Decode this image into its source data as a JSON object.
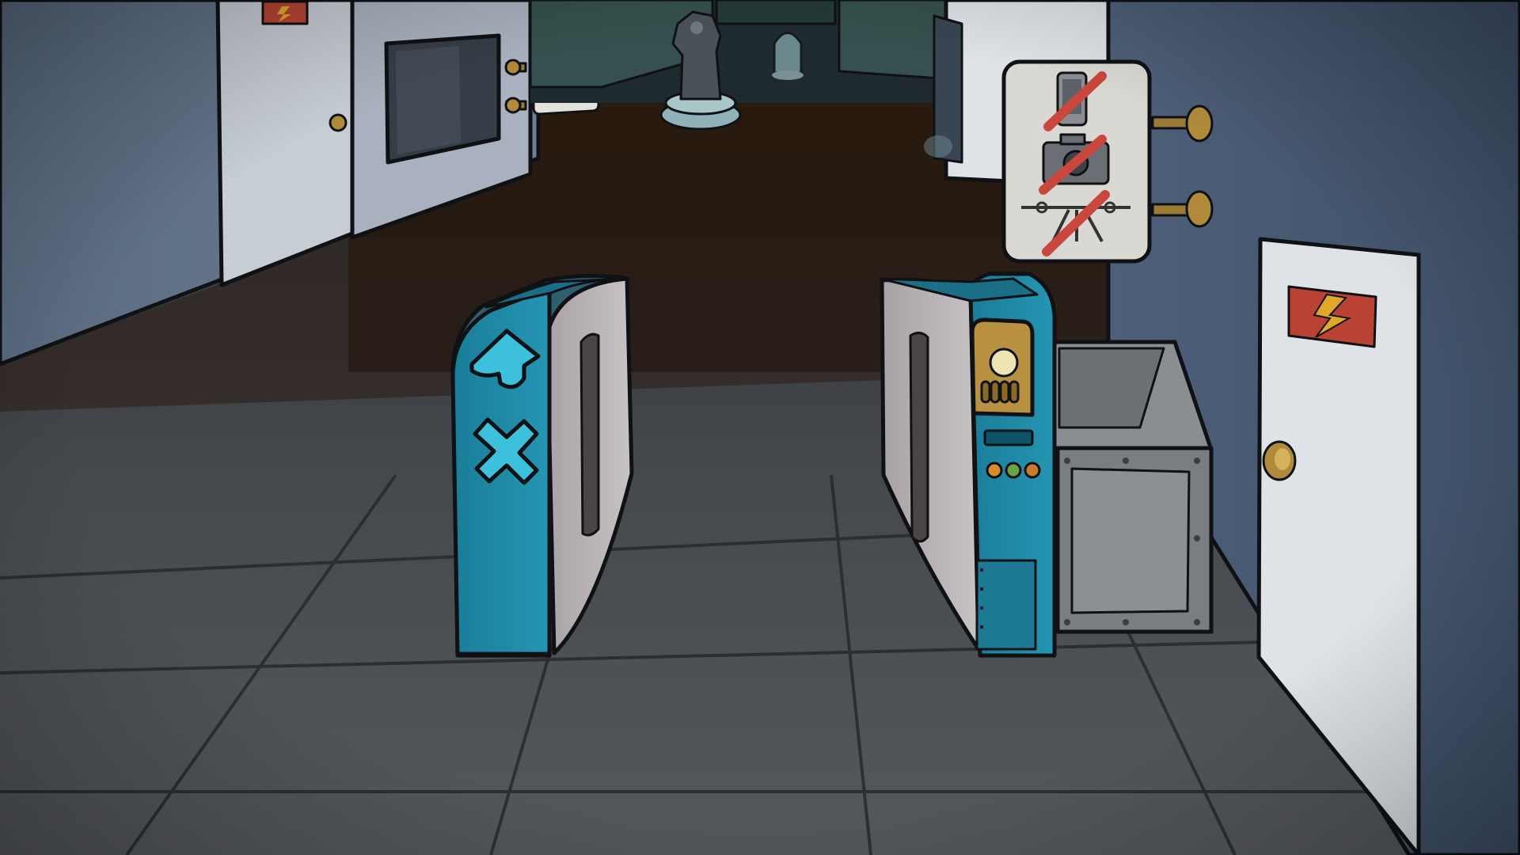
{
  "scene": {
    "name": "museum-entrance-turnstiles",
    "colors": {
      "wall": "#5b6e85",
      "wall_dark": "#2e3848",
      "floor": "#4a4d52",
      "corridor_floor": "#3a2412",
      "turnstile_teal": "#1f8aa6",
      "turnstile_side": "#b9b4b6",
      "sign_red": "#c9473c",
      "brass": "#b08a3a",
      "door_white": "#dfe3e8"
    }
  },
  "hotspots": {
    "left_turnstile": {
      "arrow_icon": "arrow-up-icon",
      "cross_icon": "cross-icon"
    },
    "right_turnstile": {
      "panel_icon": "coin-slot-icon",
      "lights": [
        "#d98a2b",
        "#6aa34a",
        "#c97a2b"
      ]
    },
    "no_photo_sign": {
      "icons": [
        "no-phone-icon",
        "no-camera-icon",
        "no-tripod-icon"
      ]
    },
    "coin_sign": {
      "icon": "coin-icon"
    },
    "electrical_sign_right": {
      "icon": "lightning-icon"
    },
    "electrical_sign_left": {
      "icon": "lightning-icon"
    }
  }
}
